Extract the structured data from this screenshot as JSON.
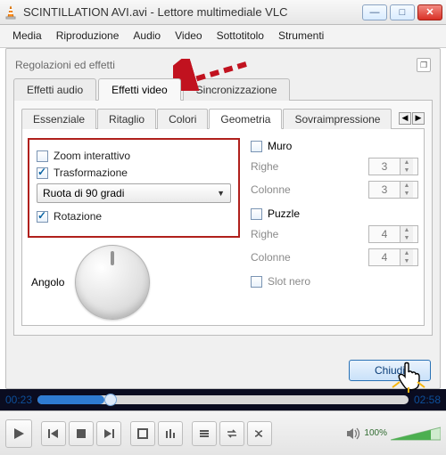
{
  "window": {
    "title": "SCINTILLATION AVI.avi - Lettore multimediale VLC"
  },
  "menubar": [
    "Media",
    "Riproduzione",
    "Audio",
    "Video",
    "Sottotitolo",
    "Strumenti"
  ],
  "dialog": {
    "title": "Regolazioni ed effetti",
    "tabs1": [
      "Effetti audio",
      "Effetti video",
      "Sincronizzazione"
    ],
    "activeTab1": 1,
    "tabs2": [
      "Essenziale",
      "Ritaglio",
      "Colori",
      "Geometria",
      "Sovraimpressione"
    ],
    "activeTab2": 3,
    "geo": {
      "zoomInteractive": {
        "label": "Zoom interattivo",
        "checked": false
      },
      "transformation": {
        "label": "Trasformazione",
        "checked": true
      },
      "comboValue": "Ruota di 90 gradi",
      "rotation": {
        "label": "Rotazione",
        "checked": true
      },
      "angleLabel": "Angolo",
      "wall": {
        "label": "Muro",
        "checked": false,
        "rowsLabel": "Righe",
        "rows": "3",
        "colsLabel": "Colonne",
        "cols": "3"
      },
      "puzzle": {
        "label": "Puzzle",
        "checked": false,
        "rowsLabel": "Righe",
        "rows": "4",
        "colsLabel": "Colonne",
        "cols": "4",
        "blackSlotLabel": "Slot nero",
        "blackSlot": false
      }
    },
    "closeBtn": "Chiudi"
  },
  "player": {
    "elapsed": "00:23",
    "total": "02:58",
    "volumePct": "100%"
  }
}
